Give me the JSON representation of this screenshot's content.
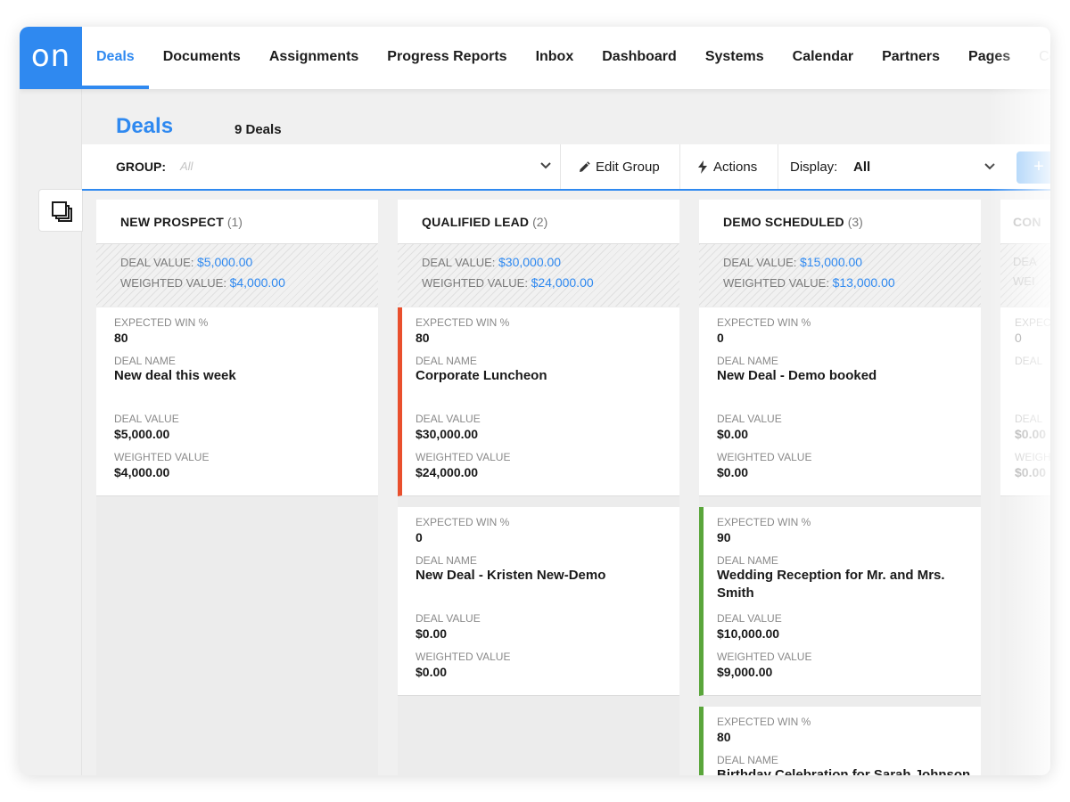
{
  "nav": {
    "logo": "on",
    "tabs": [
      {
        "label": "Deals"
      },
      {
        "label": "Documents"
      },
      {
        "label": "Assignments"
      },
      {
        "label": "Progress Reports"
      },
      {
        "label": "Inbox"
      },
      {
        "label": "Dashboard"
      },
      {
        "label": "Systems"
      },
      {
        "label": "Calendar"
      },
      {
        "label": "Partners"
      },
      {
        "label": "Pages"
      },
      {
        "label": "Con"
      }
    ],
    "active_tab": "Deals"
  },
  "page": {
    "title": "Deals",
    "count": "9 Deals"
  },
  "toolbar": {
    "group_label": "GROUP:",
    "group_value": "All",
    "edit_group": "Edit Group",
    "actions": "Actions",
    "display_label": "Display:",
    "display_value": "All",
    "add_label": "+"
  },
  "columns": [
    {
      "title": "NEW PROSPECT",
      "count": "(1)",
      "deal_value_label": "DEAL VALUE:",
      "deal_value": "$5,000.00",
      "weighted_value_label": "WEIGHTED VALUE:",
      "weighted_value": "$4,000.00",
      "cards": [
        {
          "win_label": "EXPECTED WIN %",
          "win": "80",
          "name_label": "DEAL NAME",
          "name": "New deal this week",
          "value_label": "DEAL VALUE",
          "value": "$5,000.00",
          "weighted_label": "WEIGHTED VALUE",
          "weighted": "$4,000.00"
        }
      ]
    },
    {
      "title": "QUALIFIED LEAD",
      "count": "(2)",
      "deal_value_label": "DEAL VALUE:",
      "deal_value": "$30,000.00",
      "weighted_value_label": "WEIGHTED VALUE:",
      "weighted_value": "$24,000.00",
      "cards": [
        {
          "win_label": "EXPECTED WIN %",
          "win": "80",
          "name_label": "DEAL NAME",
          "name": "Corporate Luncheon",
          "value_label": "DEAL VALUE",
          "value": "$30,000.00",
          "weighted_label": "WEIGHTED VALUE",
          "weighted": "$24,000.00"
        },
        {
          "win_label": "EXPECTED WIN %",
          "win": "0",
          "name_label": "DEAL NAME",
          "name": "New Deal - Kristen New-Demo",
          "value_label": "DEAL VALUE",
          "value": "$0.00",
          "weighted_label": "WEIGHTED VALUE",
          "weighted": "$0.00"
        }
      ]
    },
    {
      "title": "DEMO SCHEDULED",
      "count": "(3)",
      "deal_value_label": "DEAL VALUE:",
      "deal_value": "$15,000.00",
      "weighted_value_label": "WEIGHTED VALUE:",
      "weighted_value": "$13,000.00",
      "cards": [
        {
          "win_label": "EXPECTED WIN %",
          "win": "0",
          "name_label": "DEAL NAME",
          "name": "New Deal - Demo booked",
          "value_label": "DEAL VALUE",
          "value": "$0.00",
          "weighted_label": "WEIGHTED VALUE",
          "weighted": "$0.00"
        },
        {
          "win_label": "EXPECTED WIN %",
          "win": "90",
          "name_label": "DEAL NAME",
          "name": "Wedding Reception for Mr. and Mrs. Smith",
          "value_label": "DEAL VALUE",
          "value": "$10,000.00",
          "weighted_label": "WEIGHTED VALUE",
          "weighted": "$9,000.00"
        },
        {
          "win_label": "EXPECTED WIN %",
          "win": "80",
          "name_label": "DEAL NAME",
          "name": "Birthday Celebration for Sarah Johnson"
        }
      ]
    },
    {
      "title": "CON",
      "deal_value_label": "DEA",
      "weighted_value_label": "WEI",
      "cards": [
        {
          "win_label": "EXPEC",
          "win": "0",
          "name_label": "DEAL",
          "value_label": "DEAL",
          "value": "$0.00",
          "weighted_label": "WEIGH",
          "weighted": "$0.00"
        }
      ]
    }
  ],
  "colors": {
    "accent": "#2f89f0",
    "card_accent_red": "#e94f2d",
    "card_accent_green": "#5aa63b"
  },
  "icons": {
    "edit_group": "pencil-icon",
    "actions": "lightning-icon",
    "group_dropdown": "chevron-down-icon",
    "display_dropdown": "chevron-down-icon",
    "rail": "layers-icon"
  }
}
